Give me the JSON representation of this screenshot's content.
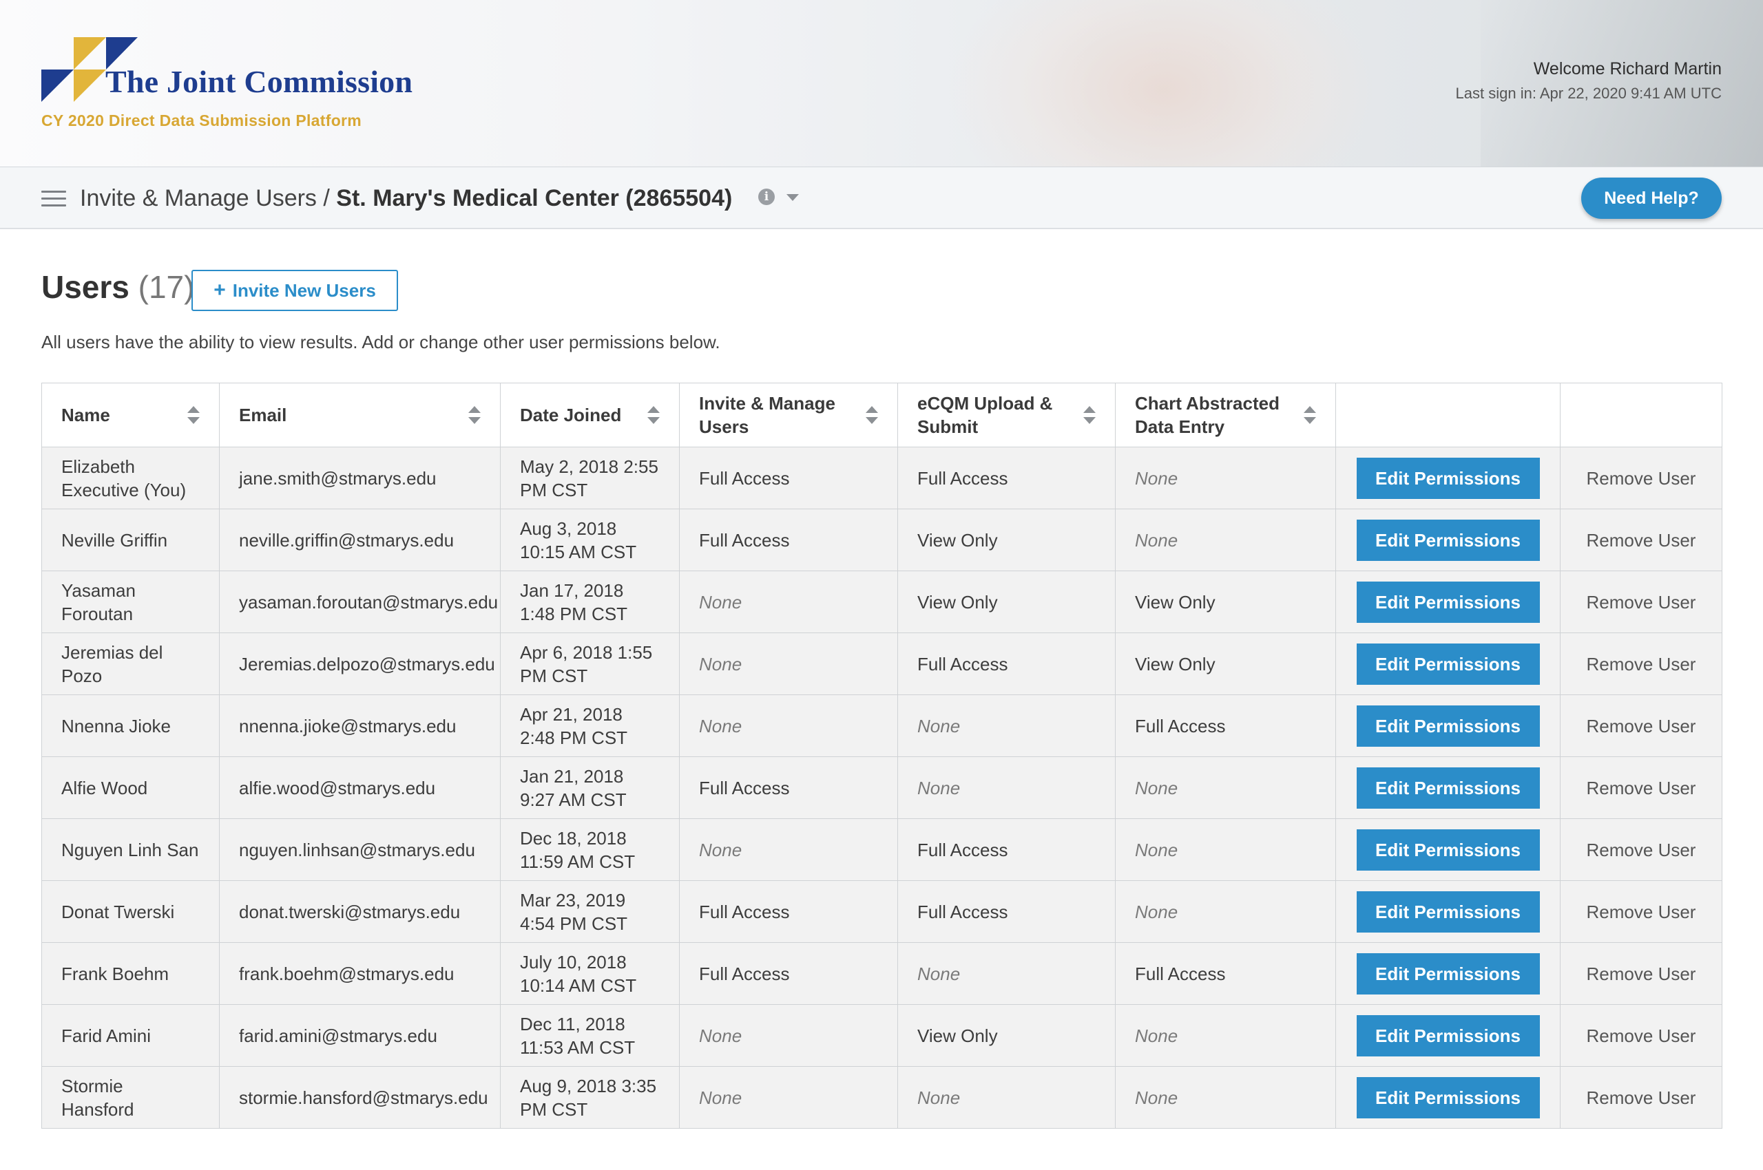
{
  "header": {
    "brand": "The Joint Commission",
    "platform": "CY 2020 Direct Data Submission Platform",
    "welcome": "Welcome Richard Martin",
    "last_sign_in": "Last sign in: Apr 22, 2020 9:41 AM UTC",
    "logo_colors": {
      "navy": "#1e3d8f",
      "gold": "#e2b53b"
    }
  },
  "nav": {
    "section": "Invite & Manage Users",
    "separator": "/",
    "organization": "St. Mary's Medical Center (2865504)",
    "info_glyph": "i",
    "help_label": "Need Help?"
  },
  "users": {
    "title": "Users",
    "count": "(17)",
    "invite_plus": "+",
    "invite_label": "Invite New Users",
    "subtitle": "All users have the ability to view results. Add or change other user permissions below."
  },
  "table": {
    "columns": [
      "Name",
      "Email",
      "Date Joined",
      "Invite & Manage Users",
      "eCQM Upload & Submit",
      "Chart Abstracted Data Entry",
      "",
      ""
    ],
    "edit_label": "Edit Permissions",
    "remove_label": "Remove User",
    "rows": [
      {
        "name": "Elizabeth Executive (You)",
        "email": "jane.smith@stmarys.edu",
        "date": "May 2, 2018 2:55 PM CST",
        "invite": "Full Access",
        "ecqm": "Full Access",
        "chart": "None"
      },
      {
        "name": "Neville Griffin",
        "email": "neville.griffin@stmarys.edu",
        "date": "Aug 3, 2018 10:15 AM CST",
        "invite": "Full Access",
        "ecqm": "View Only",
        "chart": "None"
      },
      {
        "name": "Yasaman Foroutan",
        "email": "yasaman.foroutan@stmarys.edu",
        "date": "Jan 17, 2018 1:48 PM CST",
        "invite": "None",
        "ecqm": "View Only",
        "chart": "View Only"
      },
      {
        "name": "Jeremias del Pozo",
        "email": "Jeremias.delpozo@stmarys.edu",
        "date": "Apr 6, 2018 1:55 PM CST",
        "invite": "None",
        "ecqm": "Full Access",
        "chart": "View Only"
      },
      {
        "name": "Nnenna Jioke",
        "email": "nnenna.jioke@stmarys.edu",
        "date": "Apr 21, 2018 2:48 PM CST",
        "invite": "None",
        "ecqm": "None",
        "chart": "Full Access"
      },
      {
        "name": "Alfie Wood",
        "email": "alfie.wood@stmarys.edu",
        "date": "Jan 21, 2018 9:27 AM CST",
        "invite": "Full Access",
        "ecqm": "None",
        "chart": "None"
      },
      {
        "name": "Nguyen Linh San",
        "email": "nguyen.linhsan@stmarys.edu",
        "date": "Dec 18, 2018 11:59 AM CST",
        "invite": "None",
        "ecqm": "Full Access",
        "chart": "None"
      },
      {
        "name": "Donat Twerski",
        "email": "donat.twerski@stmarys.edu",
        "date": "Mar 23, 2019 4:54 PM CST",
        "invite": "Full Access",
        "ecqm": "Full Access",
        "chart": "None"
      },
      {
        "name": "Frank Boehm",
        "email": "frank.boehm@stmarys.edu",
        "date": "July 10, 2018 10:14 AM CST",
        "invite": "Full Access",
        "ecqm": "None",
        "chart": "Full Access"
      },
      {
        "name": "Farid Amini",
        "email": "farid.amini@stmarys.edu",
        "date": "Dec 11, 2018 11:53 AM CST",
        "invite": "None",
        "ecqm": "View Only",
        "chart": "None"
      },
      {
        "name": "Stormie Hansford",
        "email": "stormie.hansford@stmarys.edu",
        "date": "Aug 9, 2018 3:35 PM CST",
        "invite": "None",
        "ecqm": "None",
        "chart": "None"
      }
    ]
  },
  "colors": {
    "accent": "#2b8dc9",
    "brand_navy": "#1e3d8f",
    "brand_gold": "#d8a733",
    "row_bg": "#f2f2f2",
    "border": "#cfd2d5"
  }
}
